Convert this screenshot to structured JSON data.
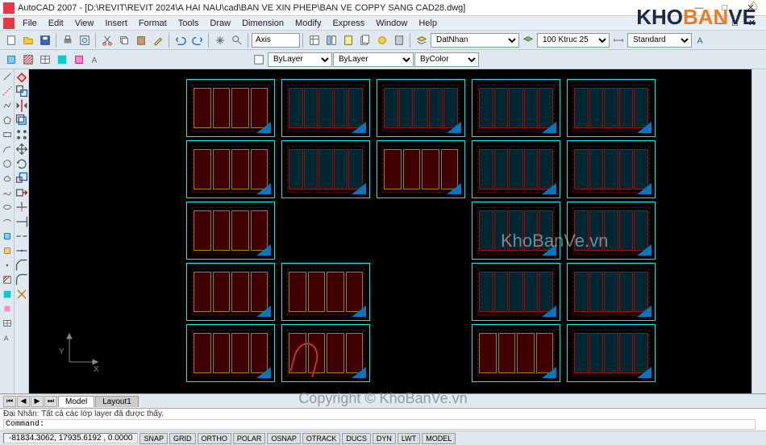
{
  "title": "AutoCAD 2007 - [D:\\REVIT\\REVIT 2024\\A HAI NAU\\cad\\BAN VE XIN PHEP\\BAN VE COPPY SANG CAD28.dwg]",
  "menu": [
    "File",
    "Edit",
    "View",
    "Insert",
    "Format",
    "Tools",
    "Draw",
    "Dimension",
    "Modify",
    "Express",
    "Window",
    "Help"
  ],
  "combos": {
    "layer": "DatNhan",
    "linetype1": "100 Ktruc 25",
    "linetype2": "Standard",
    "layerstate": "ByLayer",
    "lineweight": "ByLayer",
    "color": "ByColor",
    "axis": "Axis"
  },
  "tabs": {
    "model": "Model",
    "layout": "Layout1"
  },
  "command": {
    "history": "Đại Nhân: Tất cả các lớp layer đã được thấy.",
    "prompt": "Command:"
  },
  "status": {
    "coords": "-81834.3062, 17935.6192 , 0.0000",
    "buttons": [
      "SNAP",
      "GRID",
      "ORTHO",
      "POLAR",
      "OSNAP",
      "OTRACK",
      "DUCS",
      "DYN",
      "LWT",
      "MODEL"
    ]
  },
  "watermarks": {
    "canvas": "KhoBanVe.vn",
    "copyright": "Copyright © KhoBanVe.vn",
    "logo_a": "KHO",
    "logo_b": "BAN",
    "logo_c": "VE"
  },
  "winbtns": {
    "min": "—",
    "max": "□",
    "close": "✕"
  },
  "ucs": {
    "x": "X",
    "y": "Y"
  },
  "sheets_layout": [
    [
      "plan",
      "elev",
      "elev",
      "elev",
      "elev"
    ],
    [
      "plan",
      "elev",
      "plan",
      "elev",
      "elev"
    ],
    [
      "plan",
      "empty",
      "empty",
      "elev",
      "elev"
    ],
    [
      "plan",
      "plan",
      "empty",
      "elev",
      "elev"
    ],
    [
      "plan",
      "plan",
      "empty",
      "plan",
      "elev"
    ]
  ]
}
